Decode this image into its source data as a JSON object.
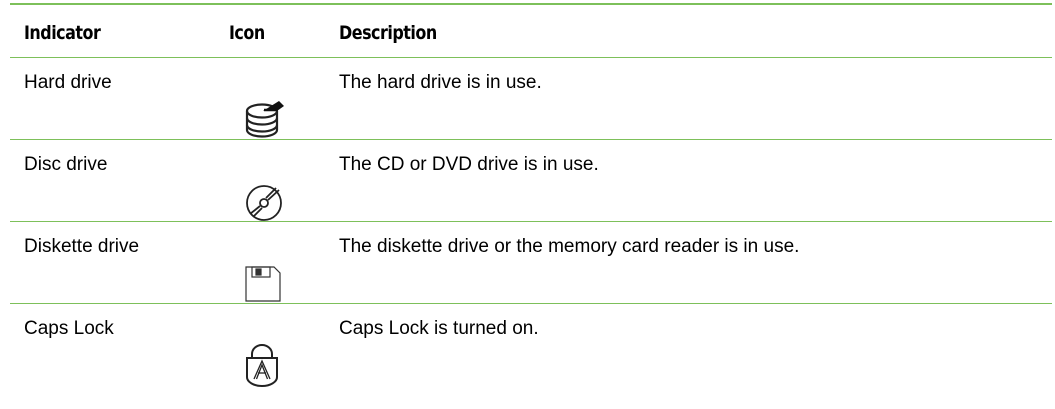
{
  "table": {
    "headers": {
      "indicator": "Indicator",
      "icon": "Icon",
      "description": "Description"
    },
    "rows": [
      {
        "indicator": "Hard drive",
        "icon": "hard-drive-icon",
        "description": "The hard drive is in use."
      },
      {
        "indicator": "Disc drive",
        "icon": "disc-drive-icon",
        "description": "The CD or DVD drive is in use."
      },
      {
        "indicator": "Diskette drive",
        "icon": "diskette-icon",
        "description": "The diskette drive or the memory card reader is in use."
      },
      {
        "indicator": "Caps Lock",
        "icon": "caps-lock-icon",
        "description": "Caps Lock is turned on."
      }
    ]
  },
  "colors": {
    "rule": "#7dc05a",
    "text": "#000000",
    "icon_stroke": "#222222"
  }
}
